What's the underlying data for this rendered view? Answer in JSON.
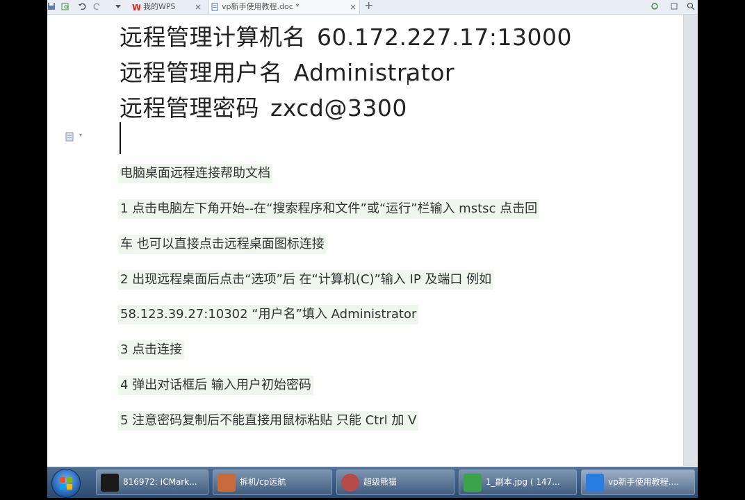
{
  "tabs": [
    {
      "label": "我的WPS",
      "close": "×"
    },
    {
      "label": "vp新手使用教程.doc *",
      "close": "×"
    }
  ],
  "new_tab": "+",
  "credentials": [
    {
      "label": "远程管理计算机名",
      "value": "60.172.227.17:13000"
    },
    {
      "label": "远程管理用户名",
      "value": "Administrator"
    },
    {
      "label": "远程管理密码",
      "value": "zxcd@3300"
    }
  ],
  "para_menu_arrow": "▾",
  "body_lines": [
    "电脑桌面远程连接帮助文档",
    "1 点击电脑左下角开始--在“搜索程序和文件”或“运行”栏输入 mstsc 点击回",
    "车 也可以直接点击远程桌面图标连接",
    "2 出现远程桌面后点击“选项”后 在“计算机(C)”输入 IP 及端口 例如",
    "58.123.39.27:10302 “用户名”填入 Administrator",
    "3 点击连接",
    "4 弹出对话框后 输入用户初始密码",
    "5 注意密码复制后不能直接用鼠标粘贴 只能 Ctrl 加 V"
  ],
  "taskbar": [
    {
      "label": "816972: ICMark...",
      "icon": "chart-app-icon",
      "color": "#1a1a1a"
    },
    {
      "label": "拆机/cp远航",
      "icon": "qq-group-icon",
      "color": "#c96a3a"
    },
    {
      "label": "超级熊猫",
      "icon": "panda-icon",
      "color": "#b84a4a"
    },
    {
      "label": "1_副本.jpg ( 147...",
      "icon": "image-viewer-icon",
      "color": "#3aa34a"
    },
    {
      "label": "vp新手使用教程....",
      "icon": "wps-writer-icon",
      "color": "#2a7de0"
    }
  ]
}
